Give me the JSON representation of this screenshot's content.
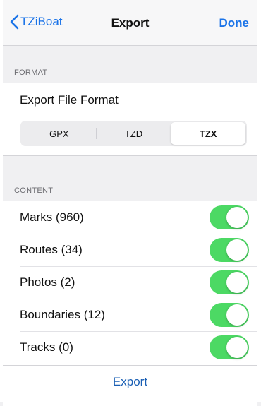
{
  "navbar": {
    "back_label": "TZiBoat",
    "title": "Export",
    "done_label": "Done"
  },
  "format_section": {
    "header": "FORMAT",
    "row_label": "Export File Format",
    "segments": [
      {
        "label": "GPX",
        "selected": false
      },
      {
        "label": "TZD",
        "selected": false
      },
      {
        "label": "TZX",
        "selected": true
      }
    ]
  },
  "content_section": {
    "header": "CONTENT",
    "items": [
      {
        "label": "Marks (960)",
        "on": true
      },
      {
        "label": "Routes (34)",
        "on": true
      },
      {
        "label": "Photos (2)",
        "on": true
      },
      {
        "label": "Boundaries (12)",
        "on": true
      },
      {
        "label": "Tracks (0)",
        "on": true
      }
    ]
  },
  "action": {
    "export_label": "Export"
  },
  "colors": {
    "accent": "#1a73e8",
    "toggle_on": "#4cd964"
  },
  "icons": {
    "back": "chevron-left-icon"
  }
}
